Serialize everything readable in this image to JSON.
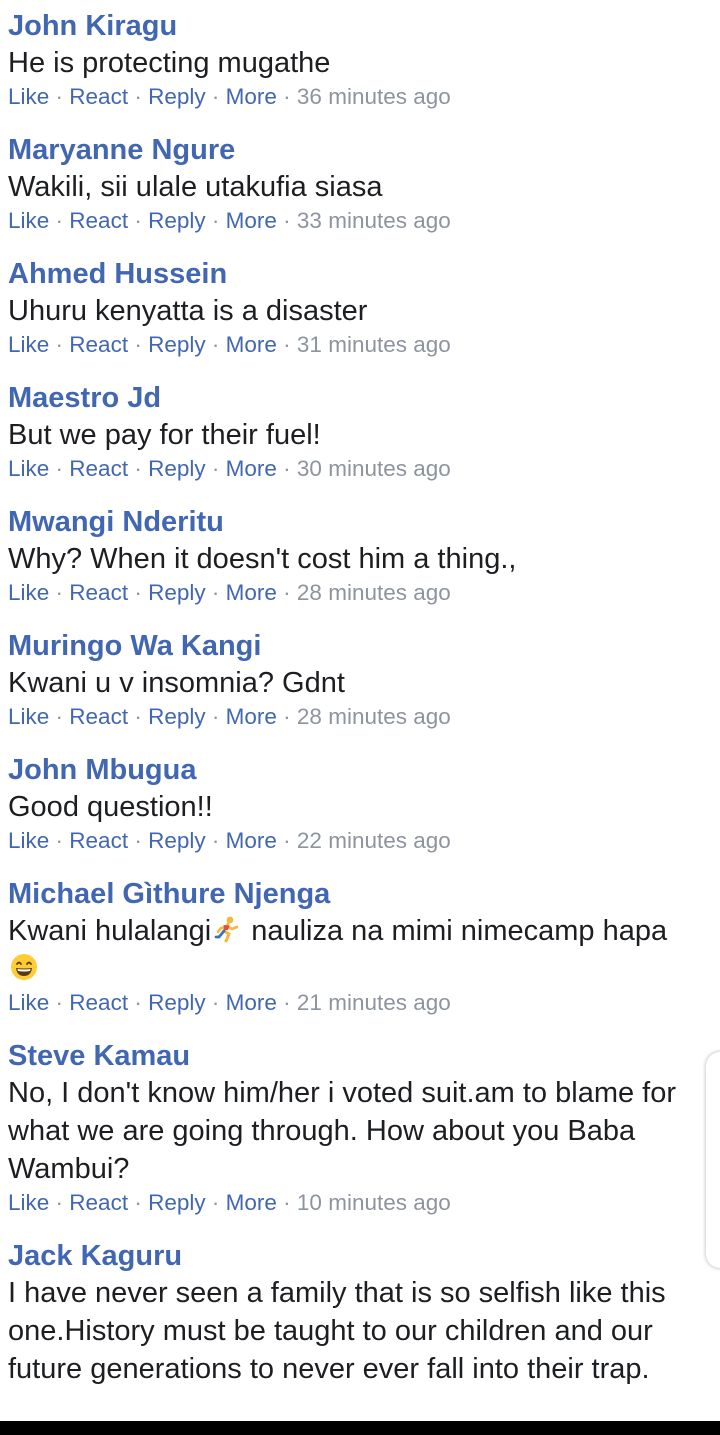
{
  "actions": {
    "like": "Like",
    "react": "React",
    "reply": "Reply",
    "more": "More",
    "separator": "·"
  },
  "comments": [
    {
      "author": "John Kiragu",
      "text": "He is protecting mugathe",
      "time": "36 minutes ago"
    },
    {
      "author": "Maryanne Ngure",
      "text": "Wakili, sii ulale utakufia siasa",
      "time": "33 minutes ago"
    },
    {
      "author": "Ahmed Hussein",
      "text": "Uhuru kenyatta is a disaster",
      "time": "31 minutes ago"
    },
    {
      "author": "Maestro Jd",
      "text": "But we pay for their fuel!",
      "time": "30 minutes ago"
    },
    {
      "author": "Mwangi Nderitu",
      "text": "Why? When it doesn't cost him a thing.,",
      "time": "28 minutes ago"
    },
    {
      "author": "Muringo Wa Kangi",
      "text": "Kwani u v insomnia? Gdnt",
      "time": "28 minutes ago"
    },
    {
      "author": "John Mbugua",
      "text": "Good question!!",
      "time": "22 minutes ago"
    },
    {
      "author": "Michael Gìthure Njenga",
      "text_part1": "Kwani hulalangi",
      "text_part2": " nauliza na mimi nimecamp hapa ",
      "emoji1": "running-person-emoji",
      "emoji2": "grinning-face-emoji",
      "time": "21 minutes ago"
    },
    {
      "author": "Steve Kamau",
      "text": "No, I don't know him/her i voted suit.am to blame for what we are going through. How about you Baba Wambui?",
      "time": "10 minutes ago"
    },
    {
      "author": "Jack Kaguru",
      "text": "I have never seen a family that is so selfish like this one.History must be taught to our children and our future generations to never ever fall into their trap."
    }
  ]
}
